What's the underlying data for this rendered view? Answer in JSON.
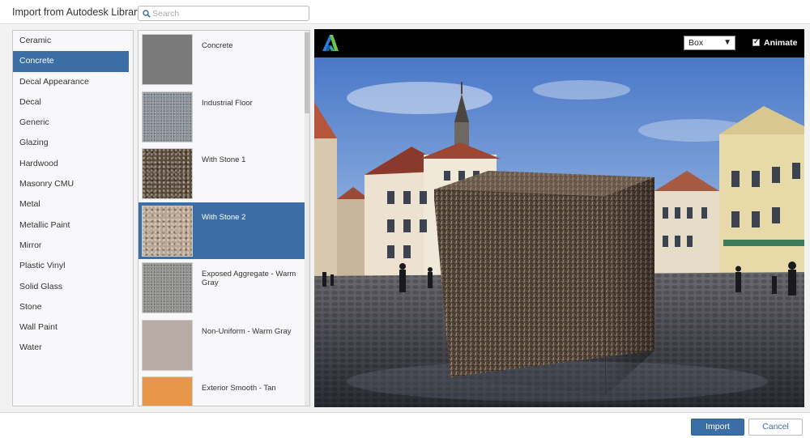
{
  "header": {
    "title": "Import from Autodesk Library",
    "search_placeholder": "Search",
    "search_value": ""
  },
  "categories": [
    {
      "label": "Ceramic",
      "selected": false
    },
    {
      "label": "Concrete",
      "selected": true
    },
    {
      "label": "Decal Appearance",
      "selected": false
    },
    {
      "label": "Decal",
      "selected": false
    },
    {
      "label": "Generic",
      "selected": false
    },
    {
      "label": "Glazing",
      "selected": false
    },
    {
      "label": "Hardwood",
      "selected": false
    },
    {
      "label": "Masonry CMU",
      "selected": false
    },
    {
      "label": "Metal",
      "selected": false
    },
    {
      "label": "Metallic Paint",
      "selected": false
    },
    {
      "label": "Mirror",
      "selected": false
    },
    {
      "label": "Plastic Vinyl",
      "selected": false
    },
    {
      "label": "Solid Glass",
      "selected": false
    },
    {
      "label": "Stone",
      "selected": false
    },
    {
      "label": "Wall Paint",
      "selected": false
    },
    {
      "label": "Water",
      "selected": false
    }
  ],
  "materials": [
    {
      "label": "Concrete",
      "swatch": "#7a7a7a",
      "texture": "smooth",
      "selected": false
    },
    {
      "label": "Industrial Floor",
      "swatch": "#8a9098",
      "texture": "fine",
      "selected": false
    },
    {
      "label": "With Stone 1",
      "swatch": "#5a4a3a",
      "texture": "coarse",
      "selected": false
    },
    {
      "label": "With Stone 2",
      "swatch": "#b8a490",
      "texture": "coarse",
      "selected": true
    },
    {
      "label": "Exposed Aggregate - Warm Gray",
      "swatch": "#8d8f8c",
      "texture": "fine",
      "selected": false
    },
    {
      "label": "Non-Uniform - Warm Gray",
      "swatch": "#b8aba6",
      "texture": "smooth",
      "selected": false
    },
    {
      "label": "Exterior Smooth - Tan",
      "swatch": "#e8964a",
      "texture": "smooth",
      "selected": false
    }
  ],
  "preview": {
    "shape_value": "Box",
    "animate_label": "Animate",
    "animate_checked": true
  },
  "footer": {
    "import_label": "Import",
    "cancel_label": "Cancel"
  },
  "colors": {
    "accent": "#3b6ea5",
    "selection": "#3b6ea5"
  }
}
